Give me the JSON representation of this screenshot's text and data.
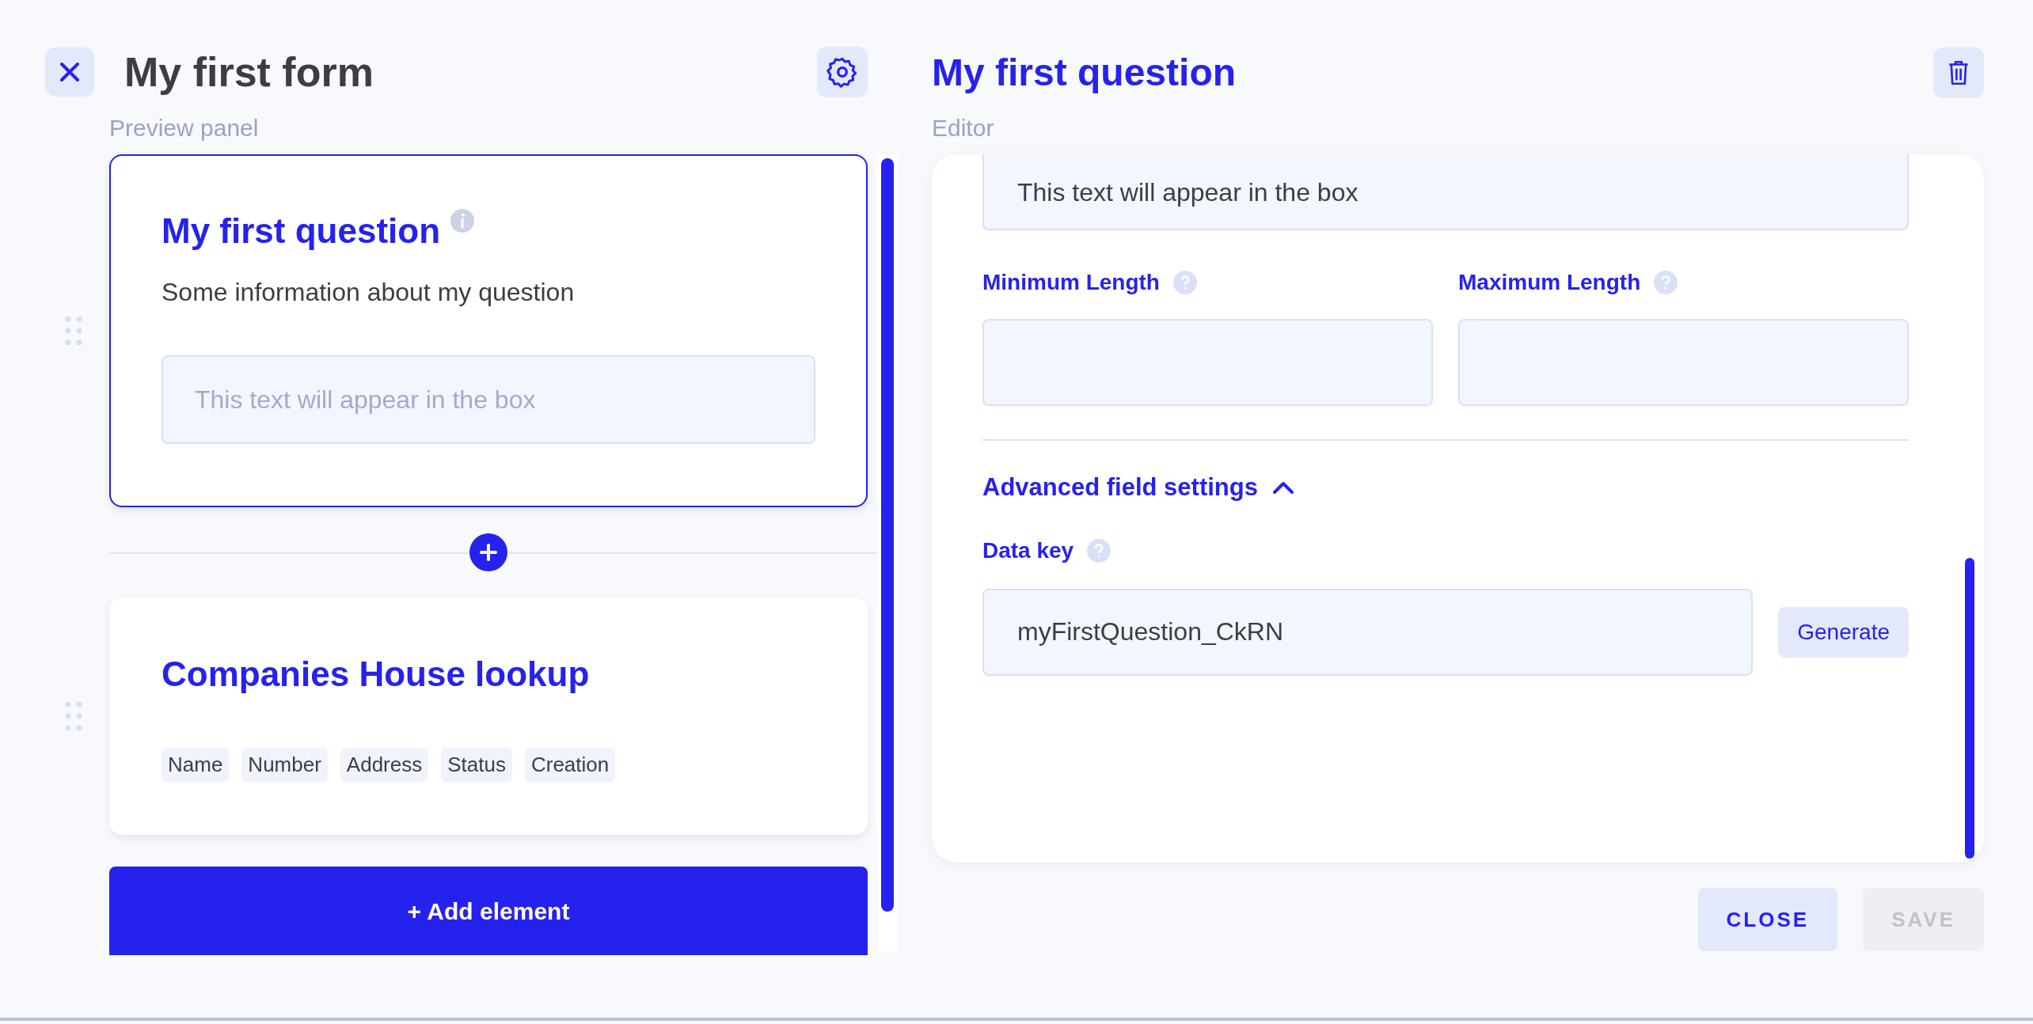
{
  "form": {
    "title": "My first form"
  },
  "preview": {
    "label": "Preview panel",
    "elements": [
      {
        "kind": "question",
        "selected": true,
        "title": "My first question",
        "description": "Some information about my question",
        "placeholder": "This text will appear in the box"
      },
      {
        "kind": "lookup",
        "selected": false,
        "title": "Companies House lookup",
        "tags": [
          "Name",
          "Number",
          "Address",
          "Status",
          "Creation"
        ]
      }
    ],
    "add_button": "+ Add element"
  },
  "editor": {
    "title": "My first question",
    "label": "Editor",
    "text_field": {
      "value": "This text will appear in the box"
    },
    "length_fields": [
      {
        "label": "Minimum Length"
      },
      {
        "label": "Maximum Length"
      }
    ],
    "advanced": {
      "label": "Advanced field settings",
      "expanded": true
    },
    "data_key": {
      "label": "Data key",
      "value": "myFirstQuestion_CkRN",
      "button": "Generate"
    }
  },
  "actions": [
    {
      "label": "CLOSE",
      "disabled": false
    },
    {
      "label": "SAVE",
      "disabled": true
    }
  ]
}
